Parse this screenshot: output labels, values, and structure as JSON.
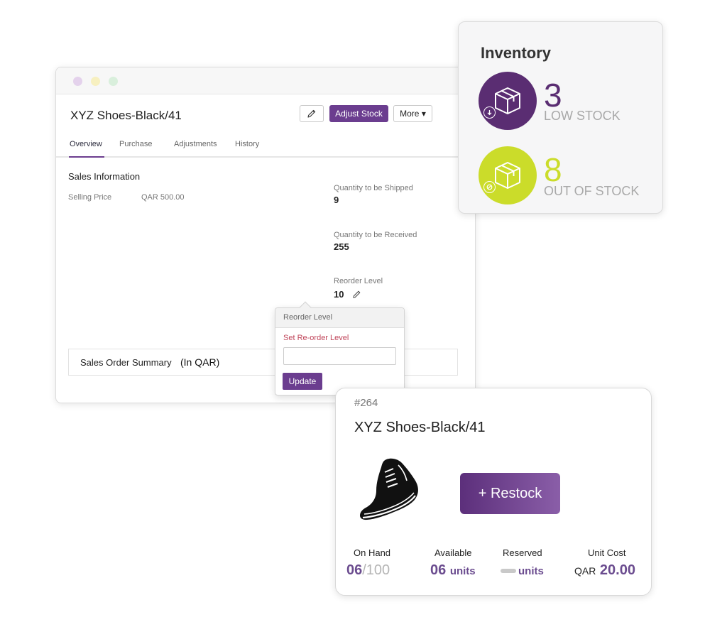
{
  "window": {
    "item_title": "XYZ Shoes-Black/41",
    "adjust_stock_label": "Adjust Stock",
    "more_label": "More ▾",
    "tabs": [
      {
        "label": "Overview",
        "active": true
      },
      {
        "label": "Purchase",
        "active": false
      },
      {
        "label": "Adjustments",
        "active": false
      },
      {
        "label": "History",
        "active": false
      }
    ],
    "sales_info": {
      "title": "Sales Information",
      "selling_price_label": "Selling Price",
      "selling_price_value": "QAR 500.00"
    },
    "quantities": {
      "to_be_shipped_label": "Quantity to be Shipped",
      "to_be_shipped_value": "9",
      "to_be_received_label": "Quantity to be Received",
      "to_be_received_value": "255",
      "reorder_level_label": "Reorder Level",
      "reorder_level_value": "10"
    },
    "sales_order_summary": {
      "label": "Sales Order Summary",
      "unit": "(In QAR)"
    }
  },
  "reorder_popover": {
    "title": "Reorder Level",
    "field_label": "Set Re-order Level",
    "field_value": "",
    "update_label": "Update"
  },
  "inventory": {
    "title": "Inventory",
    "low_stock_count": "3",
    "low_stock_label": "LOW STOCK",
    "out_of_stock_count": "8",
    "out_of_stock_label": "OUT OF STOCK",
    "colors": {
      "low": "#5a2d72",
      "out": "#cbdc2a",
      "accent": "#6b3d8f"
    }
  },
  "product_card": {
    "id": "#264",
    "name": "XYZ Shoes-Black/41",
    "restock_label": "+ Restock",
    "on_hand_label": "On Hand",
    "on_hand_value": "06",
    "on_hand_total": "/100",
    "available_label": "Available",
    "available_value": "06",
    "available_unit": "units",
    "reserved_label": "Reserved",
    "reserved_unit": "units",
    "unit_cost_label": "Unit Cost",
    "unit_cost_currency": "QAR",
    "unit_cost_value": "20.00",
    "icons": [
      "shoe-icon",
      "pencil-icon",
      "box-icon",
      "download-icon",
      "ban-icon"
    ]
  }
}
